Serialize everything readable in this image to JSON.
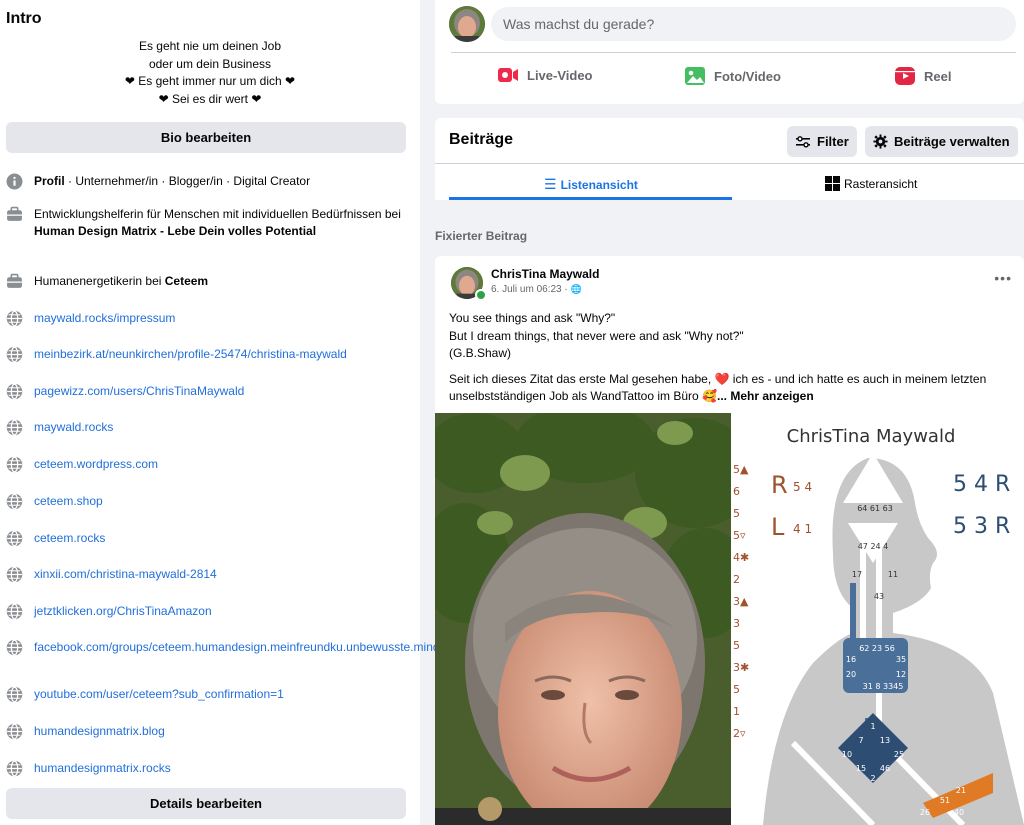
{
  "intro": {
    "title": "Intro",
    "bio_lines": [
      "Es geht nie um deinen Job",
      "oder um dein Business",
      "❤ Es geht immer nur um dich ❤",
      "❤ Sei es dir wert ❤"
    ],
    "bio_button": "Bio bearbeiten",
    "profile": {
      "bold": "Profil",
      "rest": " · Unternehmer/in · Blogger/in · Digital Creator"
    },
    "job1": {
      "text": "Entwicklungshelferin für Menschen mit individuellen Bedürfnissen bei ",
      "bold": "Human Design Matrix - Lebe Dein volles Potential"
    },
    "job2": {
      "text": "Humanenergetikerin bei ",
      "bold": "Ceteem"
    },
    "links": [
      "maywald.rocks/impressum",
      "meinbezirk.at/neunkirchen/profile-25474/christina-maywald",
      "pagewizz.com/users/ChrisTinaMaywald",
      "maywald.rocks",
      "ceteem.wordpress.com",
      "ceteem.shop",
      "ceteem.rocks",
      "xinxii.com/christina-maywald-2814",
      "jetztklicken.org/ChrisTinaAmazon",
      "facebook.com/groups/ceteem.humandesign.meinfreundku.unbewusste.mindset",
      "youtube.com/user/ceteem?sub_confirmation=1",
      "humandesignmatrix.blog",
      "humandesignmatrix.rocks"
    ],
    "details_button": "Details bearbeiten"
  },
  "composer": {
    "placeholder": "Was machst du gerade?",
    "live": "Live-Video",
    "photo": "Foto/Video",
    "reel": "Reel"
  },
  "posts": {
    "title": "Beiträge",
    "filter": "Filter",
    "manage": "Beiträge verwalten",
    "tab_list": "Listenansicht",
    "tab_grid": "Rasteransicht",
    "pinned": "Fixierter Beitrag"
  },
  "post": {
    "author": "ChrisTina Maywald",
    "date": "6. Juli um 06:23 ·",
    "lines": [
      "You see things and ask \"Why?\"",
      "But I dream things, that never were and ask \"Why not?\"",
      "(G.B.Shaw)"
    ],
    "body_a": "Seit ich dieses Zitat das erste Mal gesehen habe, ",
    "body_b": " ich es - und ich hatte es auch in meinem letzten unselbstständigen Job als WandTattoo im Büro ",
    "more": "... Mehr anzeigen",
    "chart_name": "ChrisTina Maywald",
    "chart_left_r": "R",
    "chart_left_r_num": "5 4",
    "chart_left_l": "L",
    "chart_left_l_num": "4 1",
    "chart_right_r1": "5 4 R",
    "chart_right_r2": "5 3 R",
    "chart_col": [
      "5▲",
      "6",
      "5",
      "5▿",
      "4✱",
      "2",
      "3▲",
      "3",
      "5",
      "3✱",
      "5",
      "1",
      "2▿"
    ],
    "gates_head": "64 61 63",
    "gates_ajna": "47 24 4",
    "gates_throat_a": "17",
    "gates_throat_b": "11",
    "gates_throat_c": "43",
    "gates_g1": "62 23 56",
    "gates_g2": "16",
    "gates_g3": "35",
    "gates_g4": "20",
    "gates_g5": "12",
    "gates_g6": "31 8 3345",
    "gates_d1": "1",
    "gates_d2": "7",
    "gates_d3": "13",
    "gates_d4": "10",
    "gates_d5": "25",
    "gates_d6": "15",
    "gates_d7": "46",
    "gates_d8": "2",
    "gates_o1": "21",
    "gates_o2": "51",
    "gates_o3": "26",
    "gates_o4": "40"
  },
  "colors": {
    "accent": "#1b74e4",
    "link": "#216fdb",
    "live": "#f02849",
    "photo": "#45bd62",
    "reel": "#e42645",
    "heart": "#e4183e"
  }
}
